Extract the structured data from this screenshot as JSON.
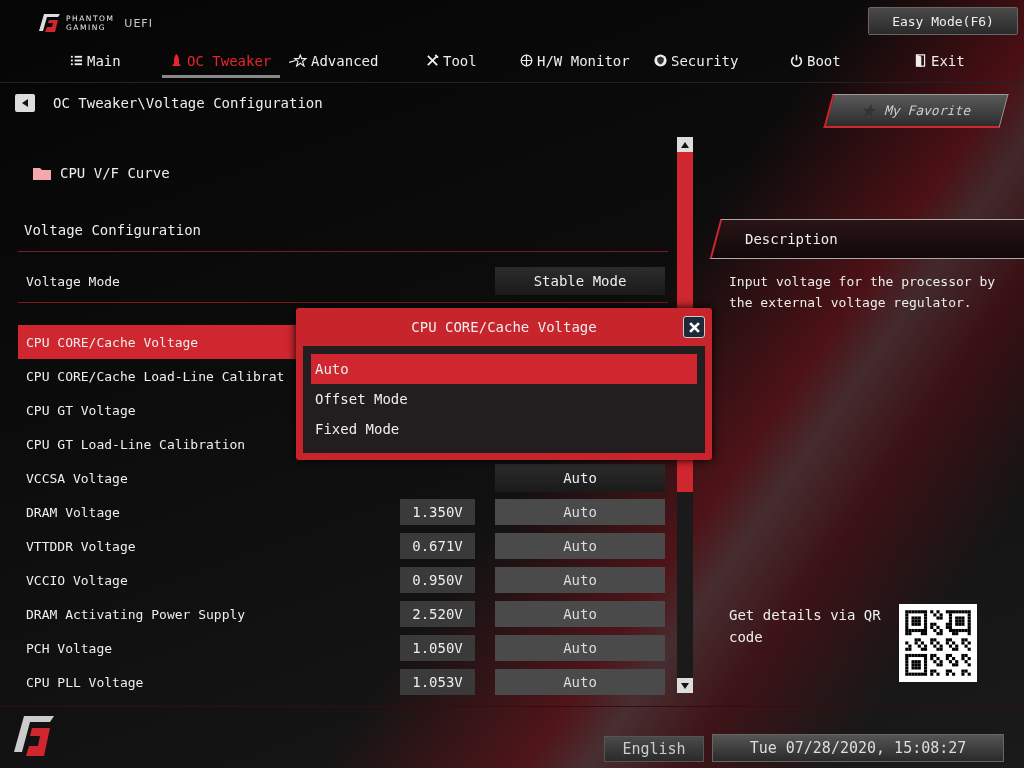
{
  "header": {
    "brand_top": "PHANTOM",
    "brand_bottom": "GAMING",
    "product": "UEFI",
    "easy_mode": "Easy Mode(F6)"
  },
  "tabs": [
    {
      "label": "Main",
      "selected": false
    },
    {
      "label": "OC Tweaker",
      "selected": true
    },
    {
      "label": "Advanced",
      "selected": false
    },
    {
      "label": "Tool",
      "selected": false
    },
    {
      "label": "H/W Monitor",
      "selected": false
    },
    {
      "label": "Security",
      "selected": false
    },
    {
      "label": "Boot",
      "selected": false
    },
    {
      "label": "Exit",
      "selected": false
    }
  ],
  "breadcrumb": "OC Tweaker\\Voltage Configuration",
  "favorite": "My Favorite",
  "items": [
    {
      "kind": "submenu",
      "label": "CPU V/F Curve"
    },
    {
      "kind": "section",
      "label": "Voltage Configuration"
    },
    {
      "kind": "setting",
      "label": "Voltage Mode",
      "value": "Stable Mode",
      "selected": false
    },
    {
      "kind": "divider"
    },
    {
      "kind": "setting",
      "label": "CPU CORE/Cache Voltage",
      "selected": true
    },
    {
      "kind": "setting",
      "label": "CPU CORE/Cache Load-Line Calibrat",
      "selected": false
    },
    {
      "kind": "setting",
      "label": "CPU GT Voltage",
      "selected": false
    },
    {
      "kind": "setting",
      "label": "CPU GT Load-Line Calibration",
      "selected": false
    },
    {
      "kind": "setting",
      "label": "VCCSA Voltage",
      "value": "Auto",
      "selected": false
    },
    {
      "kind": "setting",
      "label": "DRAM Voltage",
      "reading": "1.350V",
      "value": "Auto",
      "selected": false
    },
    {
      "kind": "setting",
      "label": "VTTDDR Voltage",
      "reading": "0.671V",
      "value": "Auto",
      "selected": false
    },
    {
      "kind": "setting",
      "label": "VCCIO Voltage",
      "reading": "0.950V",
      "value": "Auto",
      "selected": false
    },
    {
      "kind": "setting",
      "label": "DRAM Activating Power Supply",
      "reading": "2.520V",
      "value": "Auto",
      "selected": false
    },
    {
      "kind": "setting",
      "label": "PCH Voltage",
      "reading": "1.050V",
      "value": "Auto",
      "selected": false
    },
    {
      "kind": "setting",
      "label": "CPU PLL Voltage",
      "reading": "1.053V",
      "value": "Auto",
      "selected": false
    }
  ],
  "dialog": {
    "title": "CPU CORE/Cache Voltage",
    "options": [
      {
        "label": "Auto",
        "selected": true
      },
      {
        "label": "Offset Mode",
        "selected": false
      },
      {
        "label": "Fixed Mode",
        "selected": false
      }
    ]
  },
  "description": {
    "title": "Description",
    "text": "Input voltage for the processor by the external voltage regulator."
  },
  "qr_caption": "Get details via QR code",
  "status_bar": {
    "language": "English",
    "datetime": "Tue 07/28/2020, 15:08:27"
  }
}
